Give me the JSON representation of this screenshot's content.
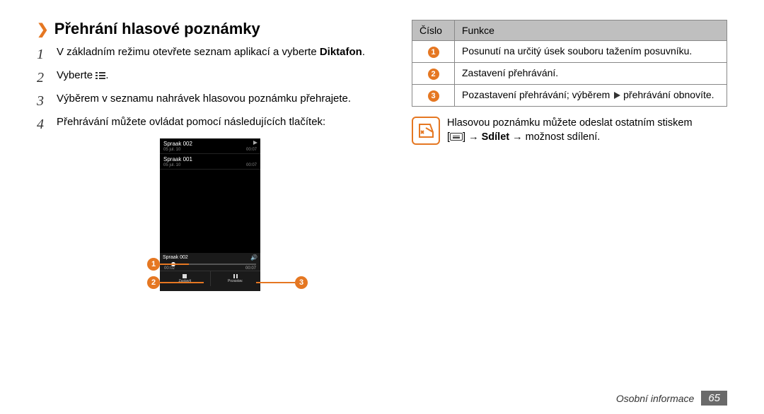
{
  "heading": "Přehrání hlasové poznámky",
  "steps": {
    "s1": {
      "num": "1",
      "text_a": "V základním režimu otevřete seznam aplikací a vyberte ",
      "bold": "Diktafon",
      "text_b": "."
    },
    "s2": {
      "num": "2",
      "text_a": "Vyberte ",
      "text_b": "."
    },
    "s3": {
      "num": "3",
      "text": "Výběrem v seznamu nahrávek hlasovou poznámku přehrajete."
    },
    "s4": {
      "num": "4",
      "text": "Přehrávání můžete ovládat pomocí následujících tlačítek:"
    }
  },
  "phone": {
    "rows": [
      {
        "name": "Spraak 002",
        "date": "05 jul. 10",
        "dur": "00:07"
      },
      {
        "name": "Spraak 001",
        "date": "05 jul. 10",
        "dur": "00:07"
      }
    ],
    "nowplaying": "Spraak 002",
    "time_cur": "00:02",
    "time_tot": "00:07",
    "btn_stop": "Zastavit",
    "btn_pause": "Pozastav."
  },
  "callouts": {
    "c1": "1",
    "c2": "2",
    "c3": "3"
  },
  "table": {
    "h1": "Číslo",
    "h2": "Funkce",
    "r1": {
      "n": "1",
      "t": "Posunutí na určitý úsek souboru tažením posuvníku."
    },
    "r2": {
      "n": "2",
      "t": "Zastavení přehrávání."
    },
    "r3": {
      "n": "3",
      "t_a": "Pozastavení přehrávání; výběrem ",
      "t_b": " přehrávání obnovíte."
    }
  },
  "note": {
    "line1": "Hlasovou poznámku můžete odeslat ostatním stiskem",
    "line2_a": "[",
    "line2_b": "] → ",
    "bold": "Sdílet",
    "line2_c": " → možnost sdílení."
  },
  "footer": {
    "label": "Osobní informace",
    "page": "65"
  }
}
